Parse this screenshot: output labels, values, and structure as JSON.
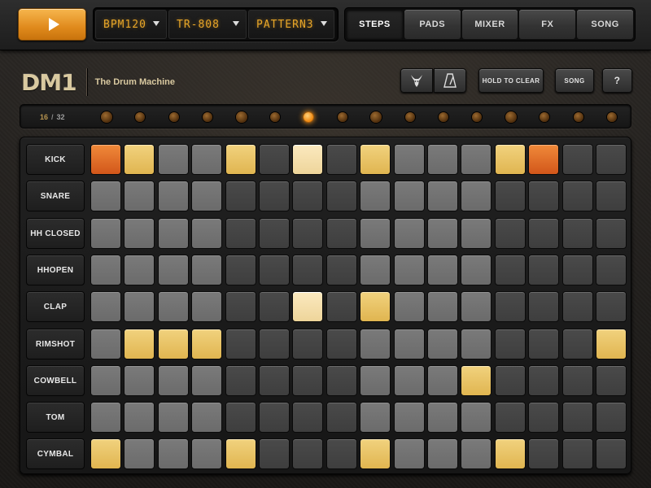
{
  "topbar": {
    "play_icon": "play-icon",
    "bpm_display": "BPM120",
    "kit_display": "TR-808",
    "pattern_display": "PATTERN3",
    "tabs": [
      {
        "label": "STEPS",
        "active": true
      },
      {
        "label": "PADS",
        "active": false
      },
      {
        "label": "MIXER",
        "active": false
      },
      {
        "label": "FX",
        "active": false
      },
      {
        "label": "SONG",
        "active": false
      }
    ]
  },
  "header": {
    "logo": "DM1",
    "subtitle": "The Drum Machine",
    "goat_icon": "goat-icon",
    "metronome_icon": "metronome-icon",
    "hold_to_clear_label": "HOLD TO CLEAR",
    "song_label": "SONG",
    "help_label": "?"
  },
  "step_indicator": {
    "current": "16",
    "separator": "/",
    "total": "32",
    "active_step_index": 6,
    "accent_color": "#f08a12"
  },
  "colors": {
    "step_on": "#e8c261",
    "step_accent": "#e06b22",
    "step_playhead": "#f4dfaa",
    "play_button": "#e8921f",
    "lcd_text": "#e8a628"
  },
  "sequencer": {
    "rows": [
      {
        "name": "KICK",
        "steps": [
          "A",
          "X",
          "_",
          "_",
          "X",
          "_",
          "P",
          "_",
          "X",
          "_",
          "_",
          "_",
          "X",
          "A",
          "_",
          "_"
        ]
      },
      {
        "name": "SNARE",
        "steps": [
          "_",
          "_",
          "_",
          "_",
          "_",
          "_",
          "_",
          "_",
          "_",
          "_",
          "_",
          "_",
          "_",
          "_",
          "_",
          "_"
        ]
      },
      {
        "name": "HH CLOSED",
        "steps": [
          "_",
          "_",
          "_",
          "_",
          "_",
          "_",
          "_",
          "_",
          "_",
          "_",
          "_",
          "_",
          "_",
          "_",
          "_",
          "_"
        ]
      },
      {
        "name": "HHOPEN",
        "steps": [
          "_",
          "_",
          "_",
          "_",
          "_",
          "_",
          "_",
          "_",
          "_",
          "_",
          "_",
          "_",
          "_",
          "_",
          "_",
          "_"
        ]
      },
      {
        "name": "CLAP",
        "steps": [
          "_",
          "_",
          "_",
          "_",
          "_",
          "_",
          "P",
          "_",
          "X",
          "_",
          "_",
          "_",
          "_",
          "_",
          "_",
          "_"
        ]
      },
      {
        "name": "RIMSHOT",
        "steps": [
          "_",
          "X",
          "X",
          "X",
          "_",
          "_",
          "_",
          "_",
          "_",
          "_",
          "_",
          "_",
          "_",
          "_",
          "_",
          "X"
        ]
      },
      {
        "name": "COWBELL",
        "steps": [
          "_",
          "_",
          "_",
          "_",
          "_",
          "_",
          "_",
          "_",
          "_",
          "_",
          "_",
          "X",
          "_",
          "_",
          "_",
          "_"
        ]
      },
      {
        "name": "TOM",
        "steps": [
          "_",
          "_",
          "_",
          "_",
          "_",
          "_",
          "_",
          "_",
          "_",
          "_",
          "_",
          "_",
          "_",
          "_",
          "_",
          "_"
        ]
      },
      {
        "name": "CYMBAL",
        "steps": [
          "X",
          "_",
          "_",
          "_",
          "X",
          "_",
          "_",
          "_",
          "X",
          "_",
          "_",
          "_",
          "X",
          "_",
          "_",
          "_"
        ]
      }
    ],
    "legend": {
      "X": "on",
      "A": "accent",
      "P": "playhead-on",
      "_": "off"
    }
  }
}
